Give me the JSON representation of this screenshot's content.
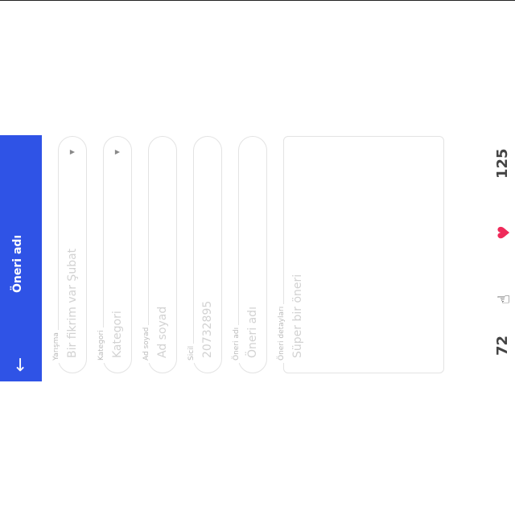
{
  "header": {
    "title": "Öneri adı"
  },
  "form": {
    "competition": {
      "label": "Yarışma",
      "value": "Bir fikrim var Şubat"
    },
    "category": {
      "label": "Kategori",
      "value": "Kategori"
    },
    "name": {
      "label": "Ad soyad",
      "value": "Ad soyad"
    },
    "registry": {
      "label": "Sicil",
      "value": "20732895"
    },
    "suggestion_name": {
      "label": "Öneri adı",
      "value": "Öneri adı"
    },
    "details": {
      "label": "Öneri detayları",
      "placeholder": "Süper bir öneri"
    }
  },
  "stats": {
    "views": "72",
    "likes": "125"
  },
  "colors": {
    "header": "#2f53e6",
    "heart": "#ef2a5a"
  },
  "icons": {
    "back": "arrow-left-icon",
    "share": "hand-pointer-icon",
    "like": "heart-icon",
    "dropdown": "caret-down-icon"
  }
}
